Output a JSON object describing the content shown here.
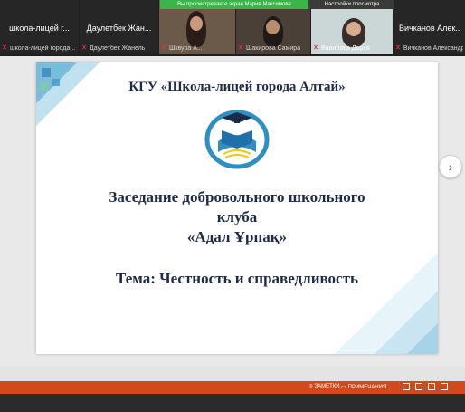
{
  "tiles": [
    {
      "big_name": "школа-лицей г...",
      "small_name": "школа-лицей города..."
    },
    {
      "big_name": "Даулетбек Жан...",
      "small_name": "Даулетбек Жанель"
    },
    {
      "small_name": "Шквура А..."
    },
    {
      "small_name": "Шакирова Самира"
    },
    {
      "small_name": "Вавилова Дарья"
    },
    {
      "big_name": "Вичканов Алек...",
      "small_name": "Вичканов Александр"
    }
  ],
  "banners": {
    "view": "Вы просматриваете экран Мария Максимова",
    "settings": "Настройки просмотра"
  },
  "slide": {
    "org": "КГУ «Школа-лицей города Алтай»",
    "title_line1": "Заседание добровольного школьного",
    "title_line2": "клуба",
    "title_line3": "«Адал Ұрпақ»",
    "topic": "Тема: Честность и справедливость"
  },
  "status": {
    "notes": "ЗАМЕТКИ",
    "comments": "ПРИМЕЧАНИЯ"
  },
  "colors": {
    "accent": "#d04a1c",
    "slide_text": "#1f2a44",
    "banner_green": "#39b54a"
  }
}
